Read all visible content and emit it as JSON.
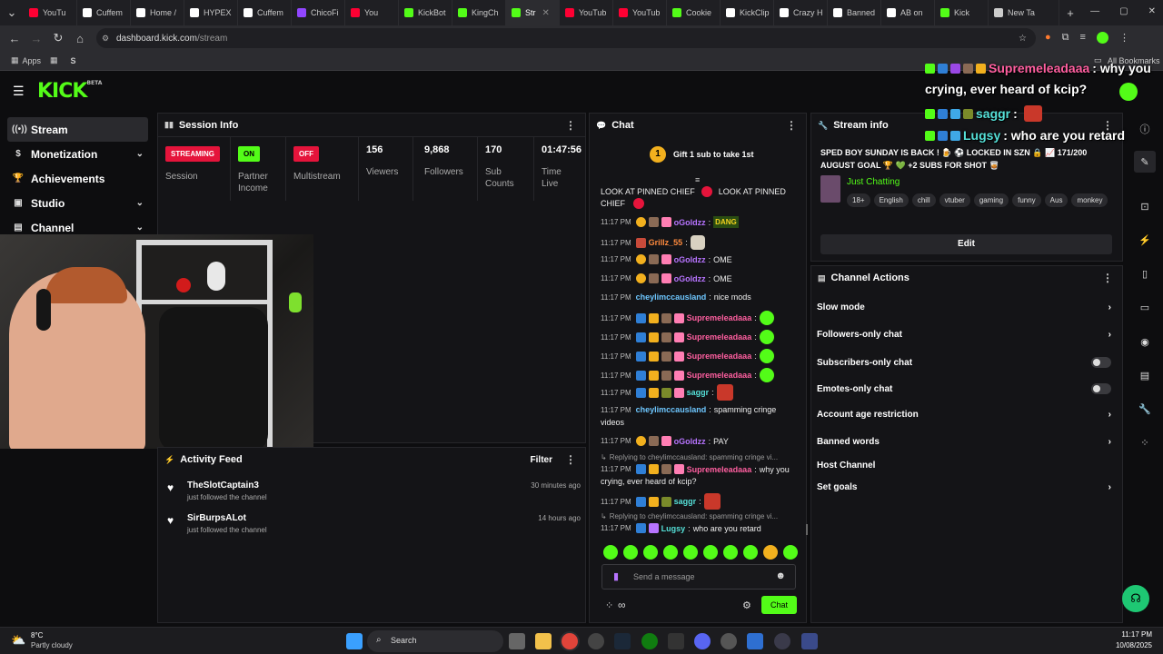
{
  "browser": {
    "tabs": [
      {
        "label": "YouTu",
        "color": "#ff0033"
      },
      {
        "label": "Cuffem",
        "color": "#ffffff"
      },
      {
        "label": "Home /",
        "color": "#ffffff"
      },
      {
        "label": "HYPEX",
        "color": "#ffffff"
      },
      {
        "label": "Cuffem",
        "color": "#ffffff"
      },
      {
        "label": "ChicoFi",
        "color": "#9146ff"
      },
      {
        "label": "You",
        "color": "#ff0033"
      },
      {
        "label": "KickBot",
        "color": "#53fc18"
      },
      {
        "label": "KingCh",
        "color": "#53fc18"
      },
      {
        "label": "Str",
        "color": "#53fc18",
        "active": true
      },
      {
        "label": "YouTub",
        "color": "#ff0033"
      },
      {
        "label": "YouTub",
        "color": "#ff0033"
      },
      {
        "label": "Cookie",
        "color": "#53fc18"
      },
      {
        "label": "KickClip",
        "color": "#ffffff"
      },
      {
        "label": "Crazy H",
        "color": "#ffffff"
      },
      {
        "label": "Banned",
        "color": "#ffffff"
      },
      {
        "label": "AB on",
        "color": "#ffffff"
      },
      {
        "label": "Kick",
        "color": "#53fc18"
      },
      {
        "label": "New Ta",
        "color": "#cccccc"
      }
    ],
    "url_host": "dashboard.kick.com",
    "url_path": "/stream",
    "bookmarks": {
      "apps": "Apps",
      "all": "All Bookmarks"
    }
  },
  "brand": {
    "logo": "KICK",
    "beta": "BETA",
    "accent": "#53fc18"
  },
  "sidebar": {
    "items": [
      {
        "label": "Stream",
        "icon": "broadcast-icon"
      },
      {
        "label": "Monetization",
        "icon": "dollar-icon"
      },
      {
        "label": "Achievements",
        "icon": "trophy-icon"
      },
      {
        "label": "Studio",
        "icon": "studio-icon"
      },
      {
        "label": "Channel",
        "icon": "channel-icon"
      }
    ]
  },
  "session": {
    "title": "Session Info",
    "streaming_pill": "STREAMING",
    "session_label": "Session",
    "partner_pill": "ON",
    "partner_label": "Partner Income",
    "multistream_pill": "OFF",
    "multistream_label": "Multistream",
    "viewers": "156",
    "viewers_label": "Viewers",
    "followers": "9,868",
    "followers_label": "Followers",
    "subs": "170",
    "subs_label": "Sub Counts",
    "time": "01:47:56",
    "time_label": "Time Live"
  },
  "activity": {
    "title": "Activity Feed",
    "filter": "Filter",
    "items": [
      {
        "name": "TheSlotCaptain3",
        "action": "just followed the channel",
        "time": "30 minutes ago"
      },
      {
        "name": "SirBurpsALot",
        "action": "just followed the channel",
        "time": "14 hours ago"
      }
    ]
  },
  "chat": {
    "title": "Chat",
    "gift_banner": "Gift 1 sub to take 1st",
    "gift_count": "1",
    "pinned_a": "LOOK AT PINNED CHIEF",
    "pinned_b": "LOOK AT PINNED",
    "pinned_c": "CHIEF",
    "time": "11:17 PM",
    "messages": [
      {
        "user": "oGoldzz",
        "text": "",
        "emote": "DANG"
      },
      {
        "user": "Grillz_55",
        "text": ""
      },
      {
        "user": "oGoldzz",
        "text": "OME"
      },
      {
        "user": "oGoldzz",
        "text": "OME"
      },
      {
        "user": "cheylimccausland",
        "text": "nice mods"
      },
      {
        "user": "Supremeleadaaa",
        "text": ""
      },
      {
        "user": "Supremeleadaaa",
        "text": ""
      },
      {
        "user": "Supremeleadaaa",
        "text": ""
      },
      {
        "user": "Supremeleadaaa",
        "text": ""
      },
      {
        "user": "saggr",
        "text": ""
      },
      {
        "user": "cheylimccausland",
        "text": "spamming cringe",
        "text2": "videos"
      },
      {
        "user": "oGoldzz",
        "text": "PAY"
      },
      {
        "reply": "Replying to cheylimccausland: spamming cringe vi...",
        "user": "Supremeleadaaa",
        "text": "why you",
        "text2": "crying, ever heard of kcip?"
      },
      {
        "user": "saggr",
        "text": ""
      },
      {
        "reply": "Replying to cheylimccausland: spamming cringe vi...",
        "user": "Lugsy",
        "text": "who are you retard"
      }
    ],
    "input_placeholder": "Send a message",
    "send_label": "Chat"
  },
  "stream_info": {
    "title": "Stream info",
    "stream_title": "SPED BOY SUNDAY IS BACK ! 🍺 ⚽ LOCKED IN SZN 🔒 📈 171/200 AUGUST GOAL 🏆 💚 +2 SUBS FOR SHOT 🥃",
    "category": "Just Chatting",
    "tags": [
      "18+",
      "English",
      "chill",
      "vtuber",
      "gaming",
      "funny",
      "Aus",
      "monkey"
    ],
    "edit_label": "Edit"
  },
  "channel_actions": {
    "title": "Channel Actions",
    "items": [
      {
        "label": "Slow mode",
        "control": "chevron"
      },
      {
        "label": "Followers-only chat",
        "control": "chevron"
      },
      {
        "label": "Subscribers-only chat",
        "control": "toggle"
      },
      {
        "label": "Emotes-only chat",
        "control": "toggle"
      },
      {
        "label": "Account age restriction",
        "control": "chevron"
      },
      {
        "label": "Banned words",
        "control": "chevron"
      },
      {
        "label": "Host Channel",
        "control": "none"
      },
      {
        "label": "Set goals",
        "control": "chevron"
      }
    ]
  },
  "overlay_chat": [
    {
      "user": "Supremeleadaaa",
      "text": ": why you",
      "text2": "crying, ever heard of kcip?"
    },
    {
      "user": "saggr",
      "text": ":"
    },
    {
      "user": "Lugsy",
      "text": ": who are you retard"
    }
  ],
  "taskbar": {
    "weather_temp": "8°C",
    "weather_desc": "Partly cloudy",
    "search": "Search",
    "time": "11:17 PM",
    "date": "10/08/2025"
  }
}
